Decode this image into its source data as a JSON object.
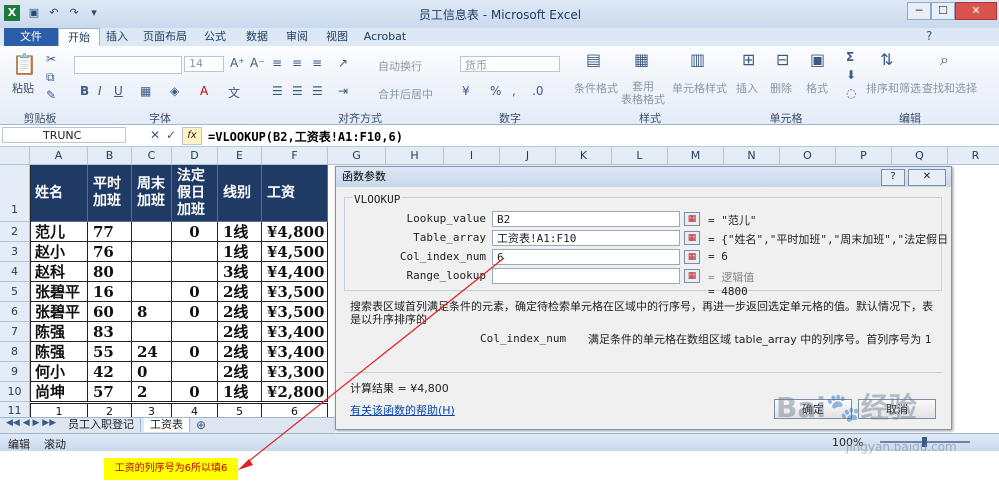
{
  "window": {
    "title": "员工信息表 - Microsoft Excel",
    "min": "─",
    "max": "☐",
    "close": "✕"
  },
  "tabs": [
    "文件",
    "开始",
    "插入",
    "页面布局",
    "公式",
    "数据",
    "审阅",
    "视图",
    "Acrobat"
  ],
  "ribbon": {
    "paste": "粘贴",
    "font_size": "14",
    "wrap_text": "自动换行",
    "merge_center": "合并后居中",
    "number_format": "货币",
    "cond_format": "条件格式",
    "table_format": "套用\n表格格式",
    "cell_styles": "单元格样式",
    "insert": "插入",
    "delete": "删除",
    "format": "格式",
    "sort_filter": "排序和筛选",
    "find_select": "查找和选择",
    "groups": [
      "剪贴板",
      "字体",
      "对齐方式",
      "数字",
      "样式",
      "单元格",
      "编辑"
    ]
  },
  "formula_bar": {
    "name_box": "TRUNC",
    "fx": "fx",
    "formula": "=VLOOKUP(B2,工资表!A1:F10,6)"
  },
  "columns": [
    "A",
    "B",
    "C",
    "D",
    "E",
    "F",
    "G",
    "H",
    "I",
    "J",
    "K",
    "L",
    "M",
    "N",
    "O",
    "P",
    "Q",
    "R"
  ],
  "rows": [
    "1",
    "2",
    "3",
    "4",
    "5",
    "6",
    "7",
    "8",
    "9",
    "10",
    "11"
  ],
  "table": {
    "headers": [
      "姓名",
      "平时\n加班",
      "周末\n加班",
      "法定\n假日\n加班",
      "线别",
      "工资"
    ],
    "data": [
      [
        "范儿",
        "77",
        "",
        "0",
        "1线",
        "¥4,800"
      ],
      [
        "赵小",
        "76",
        "",
        "",
        "1线",
        "¥4,500"
      ],
      [
        "赵科",
        "80",
        "",
        "",
        "3线",
        "¥4,400"
      ],
      [
        "张碧平",
        "16",
        "",
        "0",
        "2线",
        "¥3,500"
      ],
      [
        "张碧平",
        "60",
        "8",
        "0",
        "2线",
        "¥3,500"
      ],
      [
        "陈强",
        "83",
        "",
        "",
        "2线",
        "¥3,400"
      ],
      [
        "陈强",
        "55",
        "24",
        "0",
        "2线",
        "¥3,400"
      ],
      [
        "何小",
        "42",
        "0",
        "",
        "2线",
        "¥3,300"
      ],
      [
        "尚坤",
        "57",
        "2",
        "0",
        "1线",
        "¥2,800"
      ]
    ],
    "numbers": [
      "1",
      "2",
      "3",
      "4",
      "5",
      "6"
    ]
  },
  "sheet_tabs": [
    "员工入职登记",
    "工资表"
  ],
  "status": {
    "mode": "编辑",
    "scroll": "滚动",
    "zoom": "100%"
  },
  "dialog": {
    "title": "函数参数",
    "func": "VLOOKUP",
    "help_btn": "?",
    "args": [
      {
        "label": "Lookup_value",
        "value": "B2",
        "result": "= \"范儿\""
      },
      {
        "label": "Table_array",
        "value": "工资表!A1:F10",
        "result": "= {\"姓名\",\"平时加班\",\"周末加班\",\"法定假日"
      },
      {
        "label": "Col_index_num",
        "value": "6",
        "result": "= 6"
      },
      {
        "label": "Range_lookup",
        "value": "",
        "result": "= 逻辑值"
      }
    ],
    "total": "= 4800",
    "description": "搜索表区域首列满足条件的元素，确定待检索单元格在区域中的行序号，再进一步返回选定单元格的值。默认情况下，表是以升序排序的",
    "arg_desc_name": "Col_index_num",
    "arg_desc": "满足条件的单元格在数组区域 table_array 中的列序号。首列序号为 1",
    "calc_result": "计算结果 =  ¥4,800",
    "help_link": "有关该函数的帮助(H)",
    "ok": "确定",
    "cancel": "取消"
  },
  "annotation": "工资的列序号为6所以填6",
  "watermark": "jingyan.baidu.com"
}
